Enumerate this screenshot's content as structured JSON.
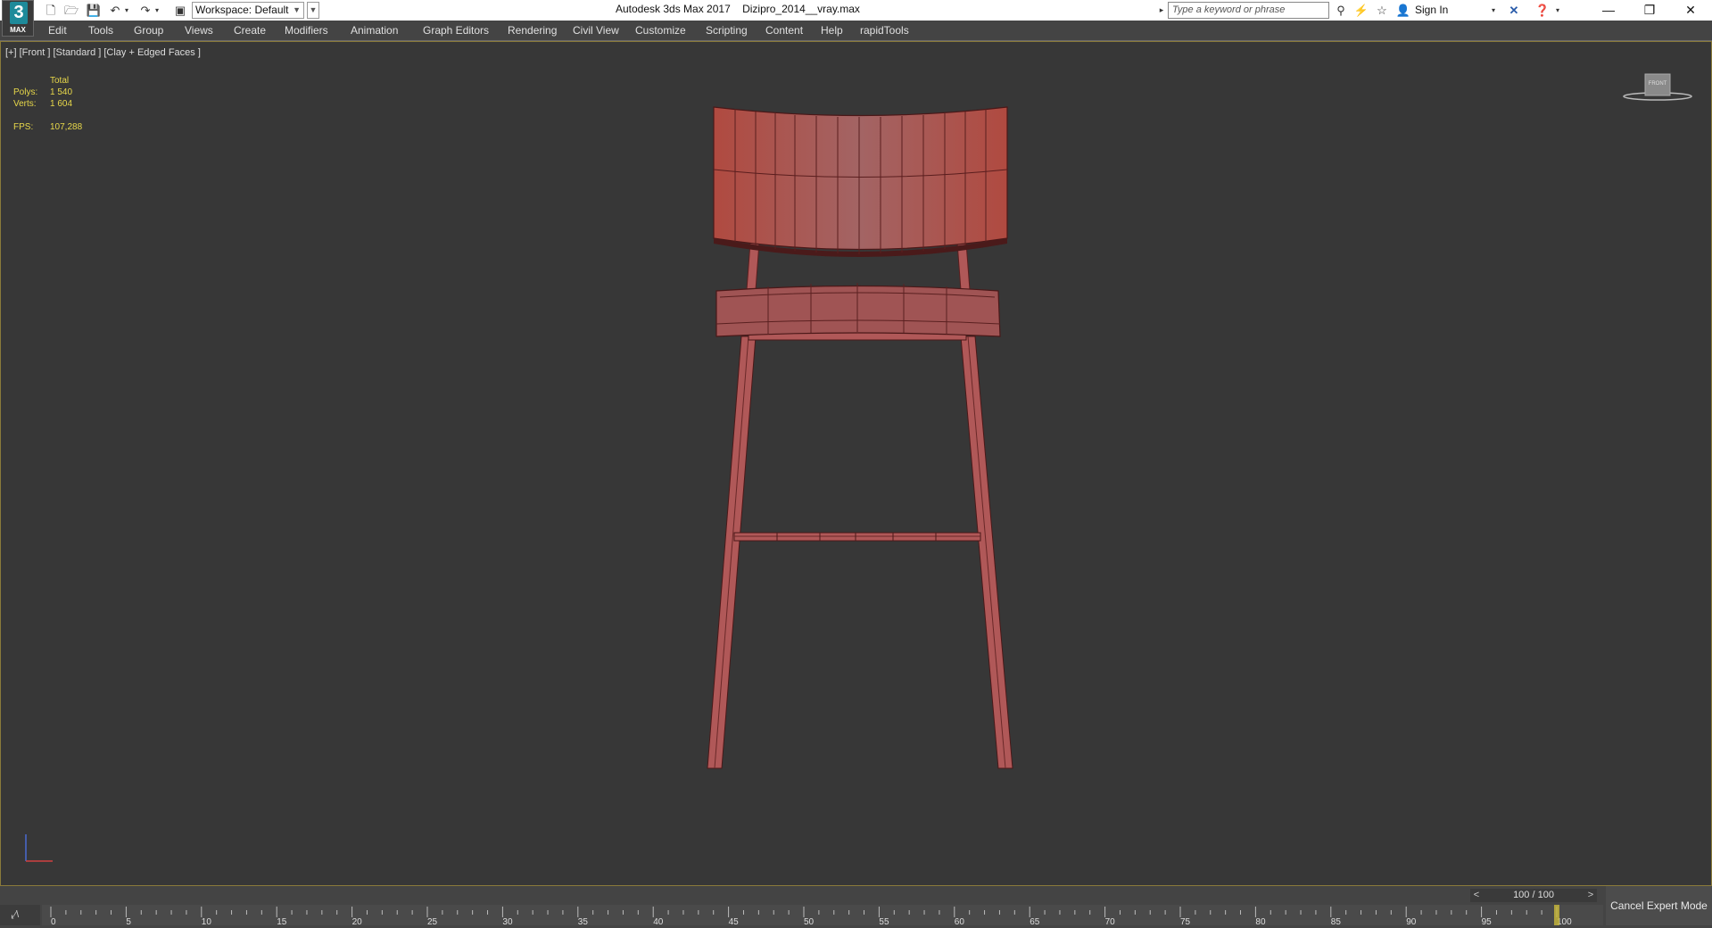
{
  "app": {
    "logo_number": "3",
    "logo_text": "MAX",
    "title": "Autodesk 3ds Max 2017    Dizipro_2014__vray.max",
    "workspace": "Workspace: Default",
    "search_placeholder": "Type a keyword or phrase",
    "sign_in": "Sign In"
  },
  "menu": {
    "items": [
      "Edit",
      "Tools",
      "Group",
      "Views",
      "Create",
      "Modifiers",
      "Animation",
      "Graph Editors",
      "Rendering",
      "Civil View",
      "Customize",
      "Scripting",
      "Content",
      "Help",
      "rapidTools"
    ]
  },
  "viewport": {
    "label": "[+] [Front ] [Standard ] [Clay + Edged Faces ]",
    "stats": {
      "header": "Total",
      "polys_label": "Polys:",
      "polys_value": "1 540",
      "verts_label": "Verts:",
      "verts_value": "1 604",
      "fps_label": "FPS:",
      "fps_value": "107,288"
    },
    "viewcube_label": "FRONT",
    "object_color": "#b85858"
  },
  "timeline": {
    "frame_counter": "100 / 100",
    "prev": "<",
    "next": ">",
    "mini_curve": "⸤⁄\\",
    "ticks": [
      "0",
      "5",
      "10",
      "15",
      "20",
      "25",
      "30",
      "35",
      "40",
      "45",
      "50",
      "55",
      "60",
      "65",
      "70",
      "75",
      "80",
      "85",
      "90",
      "95",
      "100"
    ],
    "current_frame": 100,
    "max_frame": 100
  },
  "cancel_expert_mode": "Cancel Expert Mode",
  "colors": {
    "accent": "#e8d84a",
    "viewport_bg": "#373737"
  }
}
